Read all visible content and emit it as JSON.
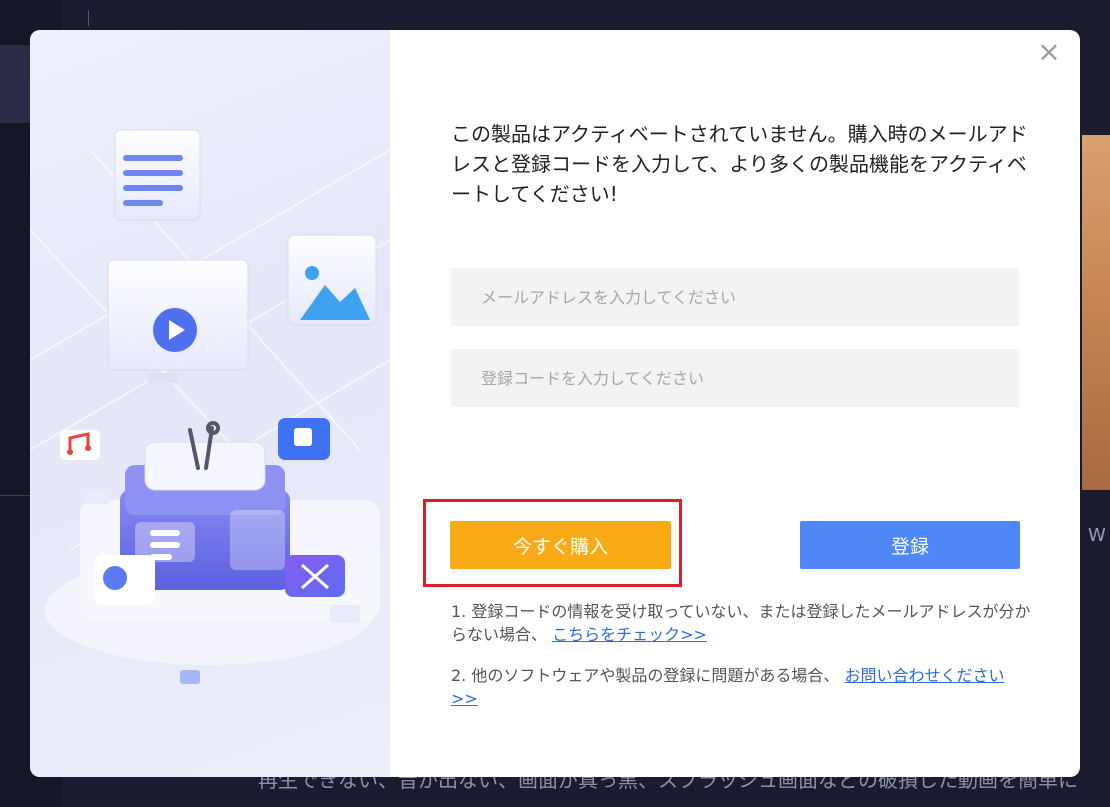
{
  "background": {
    "footer_text": "再生できない、音が出ない、画面が真っ黒、スプラッシュ画面などの破損した動画を簡単に",
    "side_letter": "W"
  },
  "dialog": {
    "close_label": "×",
    "message": "この製品はアクティベートされていません。購入時のメールアドレスと登録コードを入力して、より多くの製品機能をアクティベートしてください!",
    "email_input": {
      "value": "",
      "placeholder": "メールアドレスを入力してください"
    },
    "code_input": {
      "value": "",
      "placeholder": "登録コードを入力してください"
    },
    "buy_button_label": "今すぐ購入",
    "register_button_label": "登録",
    "note1_text": "1. 登録コードの情報を受け取っていない、または登録したメールアドレスが分からない場合、",
    "note1_link": "こちらをチェック>>",
    "note2_text": "2. 他のソフトウェアや製品の登録に問題がある場合、",
    "note2_link": "お問い合わせください>>",
    "highlight_color": "#d9202b",
    "buy_color": "#f8ab16",
    "register_color": "#4f87f7"
  },
  "illustration": {
    "icons": [
      "document-icon",
      "play-icon",
      "image-icon",
      "music-icon",
      "tools-icon",
      "box-icon"
    ]
  }
}
